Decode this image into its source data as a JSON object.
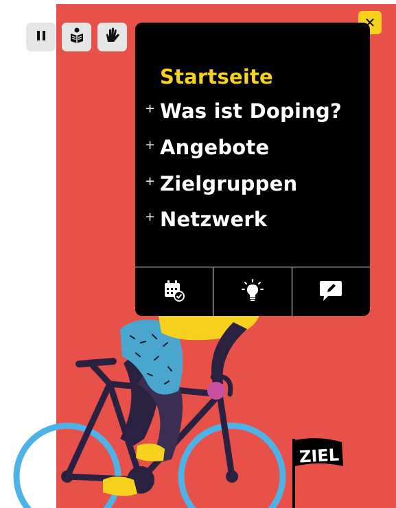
{
  "controls": {
    "pause_icon": "pause-icon",
    "reading_icon": "easy-language-icon",
    "sign_icon": "sign-language-icon"
  },
  "close_label": "✕",
  "menu": {
    "home": "Startseite",
    "items": [
      {
        "plus": "+",
        "label": "Was ist Doping?"
      },
      {
        "plus": "+",
        "label": "Angebote"
      },
      {
        "plus": "+",
        "label": "Zielgruppen"
      },
      {
        "plus": "+",
        "label": "Netzwerk"
      }
    ],
    "bottom_icons": [
      "calendar-check-icon",
      "lightbulb-icon",
      "pencil-chat-icon"
    ]
  },
  "flag_text": "ZIEL",
  "colors": {
    "background": "#e8504a",
    "accent": "#f6d21f",
    "menu_bg": "#000000",
    "wheel": "#4db3e6"
  }
}
